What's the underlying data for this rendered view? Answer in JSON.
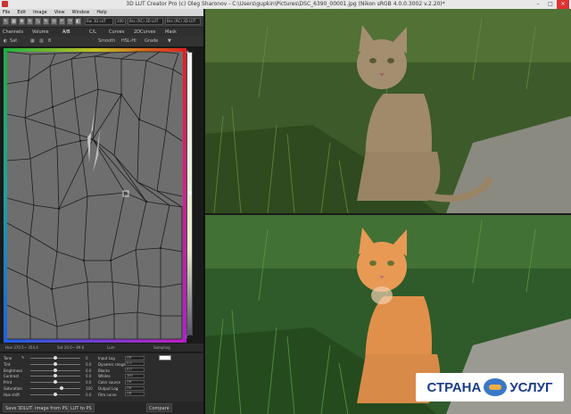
{
  "window": {
    "title": "3D LUT Creator Pro (c) Oleg Sharonov - C:\\Users\\gupkin\\Pictures\\DSC_6390_00001.jpg (Nikon sRGB 4.0.0.3002 v.2.20)*",
    "minimize": "–",
    "maximize": "□",
    "close": "✕"
  },
  "menu": [
    "File",
    "Edit",
    "Image",
    "View",
    "Window",
    "Help"
  ],
  "toolbar": {
    "field1": "Bui 3D LUT",
    "field2": "100",
    "field3": "Bsc (RC) 3D LUT",
    "field4": "Bsc (RC) 3D LUT"
  },
  "tabs": [
    "Channels",
    "Volume",
    "A/B",
    "C/L",
    "Curves",
    "2DCurves",
    "Mask"
  ],
  "subbar": {
    "left": "Sat",
    "num": "8",
    "smooth": "Smooth",
    "hsl": "HSL-Hl",
    "grade": "Grade"
  },
  "status": {
    "left": "Hue 370.5~ 354.4",
    "mid": "Sat 20.0~ 89.6",
    "lum": "Lum",
    "right": "Sampling"
  },
  "controls_left": [
    {
      "label": "Tone",
      "value": "0",
      "level": 0.5
    },
    {
      "label": "Tint",
      "value": "0.0",
      "level": 0.5
    },
    {
      "label": "Brightness",
      "value": "0.0",
      "level": 0.5
    },
    {
      "label": "Contrast",
      "value": "0.0",
      "level": 0.5
    },
    {
      "label": "Print",
      "value": "0.0",
      "level": 0.5
    },
    {
      "label": "Saturation",
      "value": "100",
      "level": 0.62
    },
    {
      "label": "Hue shift",
      "value": "0.0",
      "level": 0.5
    }
  ],
  "controls_right": [
    {
      "label": "Input Log",
      "value": "Off"
    },
    {
      "label": "Dynamic range",
      "value": "0.0"
    },
    {
      "label": "Blacks",
      "value": "0.0"
    },
    {
      "label": "Whites",
      "value": "100"
    },
    {
      "label": "Color source",
      "value": "Off"
    },
    {
      "label": "Output Log",
      "value": "Off"
    },
    {
      "label": "Film curve",
      "value": "Off"
    }
  ],
  "bottom": {
    "save": "Save 3DLUT",
    "image_from_ps": "Image from PS",
    "lut_to_ps": "LUT to PS",
    "compare": "Compare"
  },
  "watermark": {
    "left": "СТРАНА",
    "right": "УСЛУГ"
  },
  "colors": {
    "panel": "#2c2c2c",
    "grid_bg": "#6e6e6e",
    "accent_red": "#e03020",
    "accent_green": "#20a040",
    "accent_blue": "#2050e0",
    "accent_magenta": "#c030d0"
  }
}
